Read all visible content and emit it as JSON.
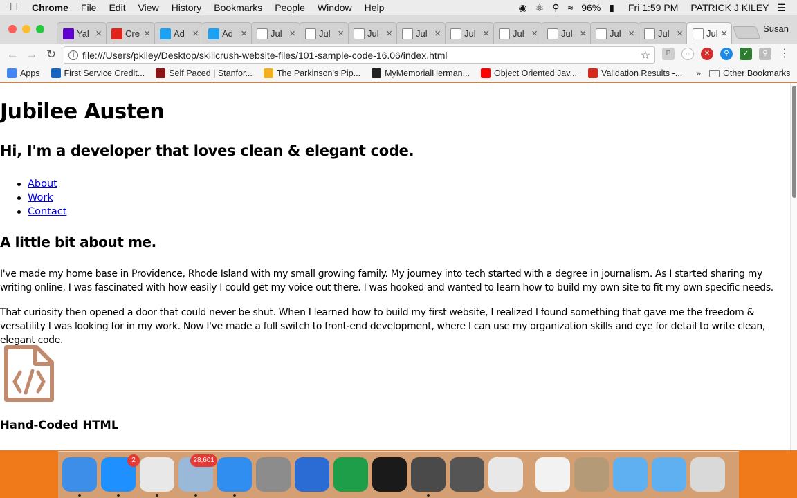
{
  "menubar": {
    "app_name": "Chrome",
    "items": [
      "File",
      "Edit",
      "View",
      "History",
      "Bookmarks",
      "People",
      "Window",
      "Help"
    ],
    "battery": "96%",
    "clock": "Fri 1:59 PM",
    "user": "PATRICK J KILEY"
  },
  "tabs": [
    {
      "label": "Yal",
      "icon": "yahoo-icon",
      "color": "#5f01d1"
    },
    {
      "label": "Cre",
      "icon": "creative-cloud-icon",
      "color": "#e2231a"
    },
    {
      "label": "Ad",
      "icon": "twitter-icon",
      "color": "#1da1f2"
    },
    {
      "label": "Ad",
      "icon": "twitter-icon",
      "color": "#1da1f2"
    },
    {
      "label": "Jul",
      "icon": "page-icon",
      "color": "#888888"
    },
    {
      "label": "Jul",
      "icon": "page-icon",
      "color": "#888888"
    },
    {
      "label": "Jul",
      "icon": "page-icon",
      "color": "#888888"
    },
    {
      "label": "Jul",
      "icon": "page-icon",
      "color": "#888888"
    },
    {
      "label": "Jul",
      "icon": "page-icon",
      "color": "#888888"
    },
    {
      "label": "Jul",
      "icon": "page-icon",
      "color": "#888888"
    },
    {
      "label": "Jul",
      "icon": "page-icon",
      "color": "#888888"
    },
    {
      "label": "Jul",
      "icon": "page-icon",
      "color": "#888888"
    },
    {
      "label": "Jul",
      "icon": "page-icon",
      "color": "#888888"
    },
    {
      "label": "Jul",
      "icon": "page-icon",
      "color": "#888888",
      "active": true
    }
  ],
  "profile_name": "Susan",
  "address_bar": {
    "url": "file:///Users/pkiley/Desktop/skillcrush-website-files/101-sample-code-16.06/index.html"
  },
  "bookmarks": [
    {
      "label": "Apps",
      "icon": "apps-grid-icon",
      "color": "#4285f4"
    },
    {
      "label": "First Service Credit...",
      "icon": "credit-union-icon",
      "color": "#1565c0"
    },
    {
      "label": "Self Paced | Stanfor...",
      "icon": "stanford-icon",
      "color": "#8c1515"
    },
    {
      "label": "The Parkinson's Pip...",
      "icon": "parkinsons-icon",
      "color": "#f2b01e"
    },
    {
      "label": "MyMemorialHerman...",
      "icon": "memorial-hermann-icon",
      "color": "#222222"
    },
    {
      "label": "Object Oriented Jav...",
      "icon": "youtube-icon",
      "color": "#ff0000"
    },
    {
      "label": "Validation Results -...",
      "icon": "validator-icon",
      "color": "#d42a1e"
    }
  ],
  "bookmarks_overflow": "»",
  "other_bookmarks": "Other Bookmarks",
  "page": {
    "name": "Jubilee Austen",
    "tagline": "Hi, I'm a developer that loves clean & elegant code.",
    "nav": [
      "About",
      "Work",
      "Contact"
    ],
    "about_heading": "A little bit about me.",
    "about_p1": "I've made my home base in Providence, Rhode Island with my small growing family. My journey into tech started with a degree in journalism. As I started sharing my writing online, I was fascinated with how easily I could get my voice out there. I was hooked and wanted to learn how to build my own site to fit my own specific needs.",
    "about_p2": "That curiosity then opened a door that could never be shut. When I learned how to build my first website, I realized I found something that gave me the freedom & versatility I was looking for in my work. Now I've made a full switch to front-end development, where I can use my organization skills and eye for detail to write clean, elegant code.",
    "skill_heading": "Hand-Coded HTML",
    "skill_icon_color": "#c08a6e"
  },
  "dock": [
    {
      "name": "finder-icon",
      "color": "#3d8ee8",
      "running": true
    },
    {
      "name": "app-store-icon",
      "color": "#1e90ff",
      "badge": "2",
      "running": true
    },
    {
      "name": "chrome-icon",
      "color": "#e8e8e8",
      "running": true
    },
    {
      "name": "mail-icon",
      "color": "#9ab8d8",
      "badge": "28,601",
      "running": true
    },
    {
      "name": "safari-icon",
      "color": "#2f8ef0",
      "running": true
    },
    {
      "name": "system-preferences-icon",
      "color": "#8c8c8c",
      "running": false
    },
    {
      "name": "word-icon",
      "color": "#2b6cd4",
      "running": false
    },
    {
      "name": "excel-icon",
      "color": "#1f9e4a",
      "running": false
    },
    {
      "name": "terminal-icon",
      "color": "#1a1a1a",
      "running": false
    },
    {
      "name": "sublime-text-icon",
      "color": "#4a4a4a",
      "running": true
    },
    {
      "name": "printer-icon",
      "color": "#555555",
      "running": false
    },
    {
      "name": "chrome-canary-icon",
      "color": "#e8e8e8",
      "running": false
    },
    {
      "name": "xml-file-icon",
      "color": "#f2f2f2",
      "running": false
    },
    {
      "name": "photo-stack-icon",
      "color": "#b59a78",
      "running": false
    },
    {
      "name": "folder-icon",
      "color": "#5fb0f0",
      "running": false
    },
    {
      "name": "documents-folder-icon",
      "color": "#5fb0f0",
      "running": false
    },
    {
      "name": "trash-icon",
      "color": "#d9d9d9",
      "running": false
    }
  ]
}
